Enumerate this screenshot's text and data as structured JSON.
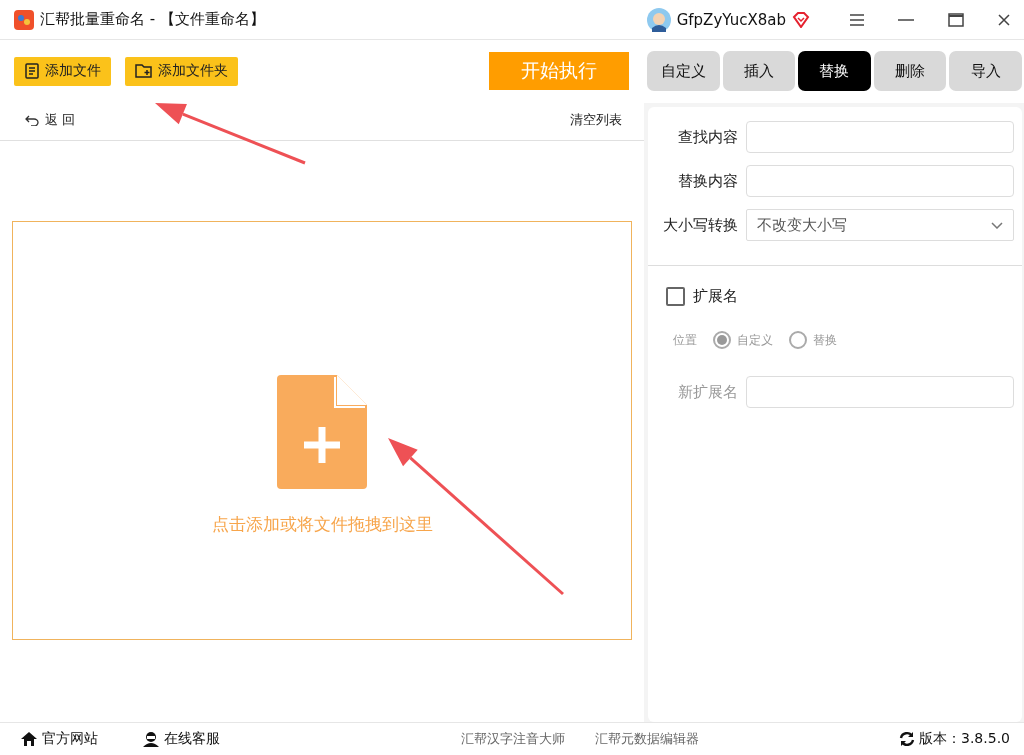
{
  "window": {
    "title": "汇帮批量重命名 - 【文件重命名】"
  },
  "user": {
    "name": "GfpZyYucX8ab"
  },
  "toolbar": {
    "buttons": [
      {
        "kind": "file",
        "label": "添加文件"
      },
      {
        "kind": "folder",
        "label": "添加文件夹"
      }
    ],
    "start_button": "开始执行"
  },
  "list_header": {
    "back": "返 回",
    "clear": "清空列表"
  },
  "dropzone": {
    "text": "点击添加或将文件拖拽到这里"
  },
  "tabs": [
    {
      "label": "自定义",
      "selected": false
    },
    {
      "label": "插入",
      "selected": false
    },
    {
      "label": "替换",
      "selected": true
    },
    {
      "label": "删除",
      "selected": false
    },
    {
      "label": "导入",
      "selected": false
    }
  ],
  "form": {
    "fields": [
      {
        "kind": "text",
        "label": "查找内容"
      },
      {
        "kind": "text",
        "label": "替换内容"
      },
      {
        "kind": "select",
        "label": "大小写转换",
        "value": "不改变大小写"
      }
    ]
  },
  "extension": {
    "label": "扩展名",
    "checked": false,
    "disabled": true,
    "position_label": "位置",
    "radios": [
      {
        "label": "自定义",
        "selected": true
      },
      {
        "label": "替换",
        "selected": false
      }
    ],
    "new_label": "新扩展名"
  },
  "footer": {
    "left": [
      {
        "kind": "home",
        "label": "官方网站"
      },
      {
        "kind": "support",
        "label": "在线客服"
      }
    ],
    "links": [
      "汇帮汉字注音大师",
      "汇帮元数据编辑器"
    ],
    "version": "版本：3.8.5.0"
  },
  "annotations": [
    {
      "kind": "arrow"
    },
    {
      "kind": "arrow"
    }
  ]
}
